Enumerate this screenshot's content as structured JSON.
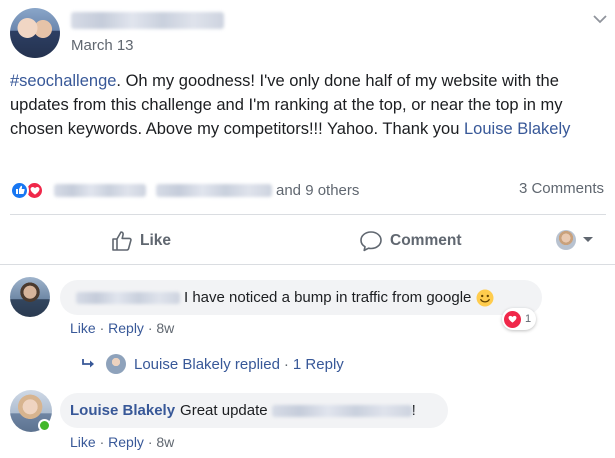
{
  "post": {
    "date": "March 13",
    "hashtag": "#seochallenge",
    "text": ". Oh my goodness! I've only done half of my website with the updates from this challenge and I'm ranking at the top, or near the top in my chosen keywords. Above my competitors!!! Yahoo. Thank you ",
    "mention": "Louise Blakely"
  },
  "stats": {
    "others": "and 9 others",
    "comments": "3 Comments"
  },
  "actions": {
    "like": "Like",
    "comment": "Comment"
  },
  "comments": [
    {
      "text": "I have noticed a bump in traffic from google",
      "reaction_count": "1",
      "like": "Like",
      "reply": "Reply",
      "sep": "·",
      "age": "8w"
    },
    {
      "name": "Louise Blakely",
      "text": "Great update",
      "tail": "!",
      "like": "Like",
      "reply": "Reply",
      "sep": "·",
      "age": "8w"
    }
  ],
  "reply_summary": {
    "label": "Louise Blakely replied",
    "sep": "·",
    "count": "1 Reply"
  },
  "colors": {
    "link": "#385898",
    "like_blue": "#1877f2",
    "love_red": "#f0284a",
    "online_green": "#42b72a"
  },
  "icons": [
    "options-chevron-icon",
    "like-reaction-icon",
    "love-reaction-icon",
    "thumbs-up-icon",
    "comment-icon",
    "reply-arrow-icon",
    "smile-emoji-icon",
    "heart-icon"
  ]
}
